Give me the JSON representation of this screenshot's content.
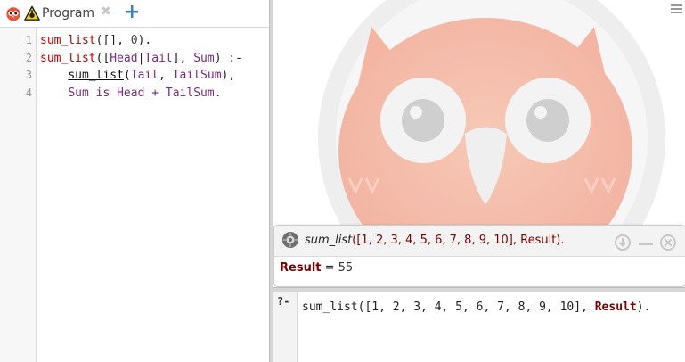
{
  "tab": {
    "label": "Program",
    "close_glyph": "✖",
    "add_glyph": "+",
    "icons": [
      "swish-owl-icon",
      "warning-icon"
    ]
  },
  "editor": {
    "line_numbers": [
      "1",
      "2",
      "3",
      "4"
    ],
    "lines": [
      [
        {
          "t": "sum_list",
          "c": "c-red"
        },
        {
          "t": "([], ",
          "c": "c-dk"
        },
        {
          "t": "0",
          "c": "c-num"
        },
        {
          "t": ").",
          "c": "c-dk"
        }
      ],
      [
        {
          "t": "sum_list",
          "c": "c-red"
        },
        {
          "t": "([",
          "c": "c-dk"
        },
        {
          "t": "Head",
          "c": "c-var"
        },
        {
          "t": "|",
          "c": "c-dk"
        },
        {
          "t": "Tail",
          "c": "c-var"
        },
        {
          "t": "], ",
          "c": "c-dk"
        },
        {
          "t": "Sum",
          "c": "c-var"
        },
        {
          "t": ") :-",
          "c": "c-dk"
        }
      ],
      [
        {
          "t": "    ",
          "c": "c-dk"
        },
        {
          "t": "sum_list",
          "c": "c-ul"
        },
        {
          "t": "(",
          "c": "c-dk"
        },
        {
          "t": "Tail",
          "c": "c-var"
        },
        {
          "t": ", ",
          "c": "c-dk"
        },
        {
          "t": "TailSum",
          "c": "c-var"
        },
        {
          "t": "),",
          "c": "c-dk"
        }
      ],
      [
        {
          "t": "    ",
          "c": "c-dk"
        },
        {
          "t": "Sum",
          "c": "c-var"
        },
        {
          "t": " is ",
          "c": "c-op"
        },
        {
          "t": "Head",
          "c": "c-var"
        },
        {
          "t": " + ",
          "c": "c-op"
        },
        {
          "t": "TailSum",
          "c": "c-var"
        },
        {
          "t": ".",
          "c": "c-dk"
        }
      ]
    ]
  },
  "runner": {
    "query_pred": "sum_list",
    "query_args_before": "([1, 2, 3, 4, 5, 6, 7, 8, 9, 10], ",
    "query_var": "Result",
    "query_end": ").",
    "controls": [
      "download-icon",
      "minimize-icon",
      "close-icon"
    ],
    "result_var": "Result",
    "result_eq": " = 55"
  },
  "query_editor": {
    "prompt": "?-",
    "text_before": "sum_list([1, 2, 3, 4, 5, 6, 7, 8, 9, 10], ",
    "text_var": "Result",
    "text_after": ")."
  },
  "colors": {
    "accent_blue": "#3a82c4",
    "prolog_red": "#c00000",
    "variable": "#7a2a7a",
    "result_var": "#7a0000"
  }
}
